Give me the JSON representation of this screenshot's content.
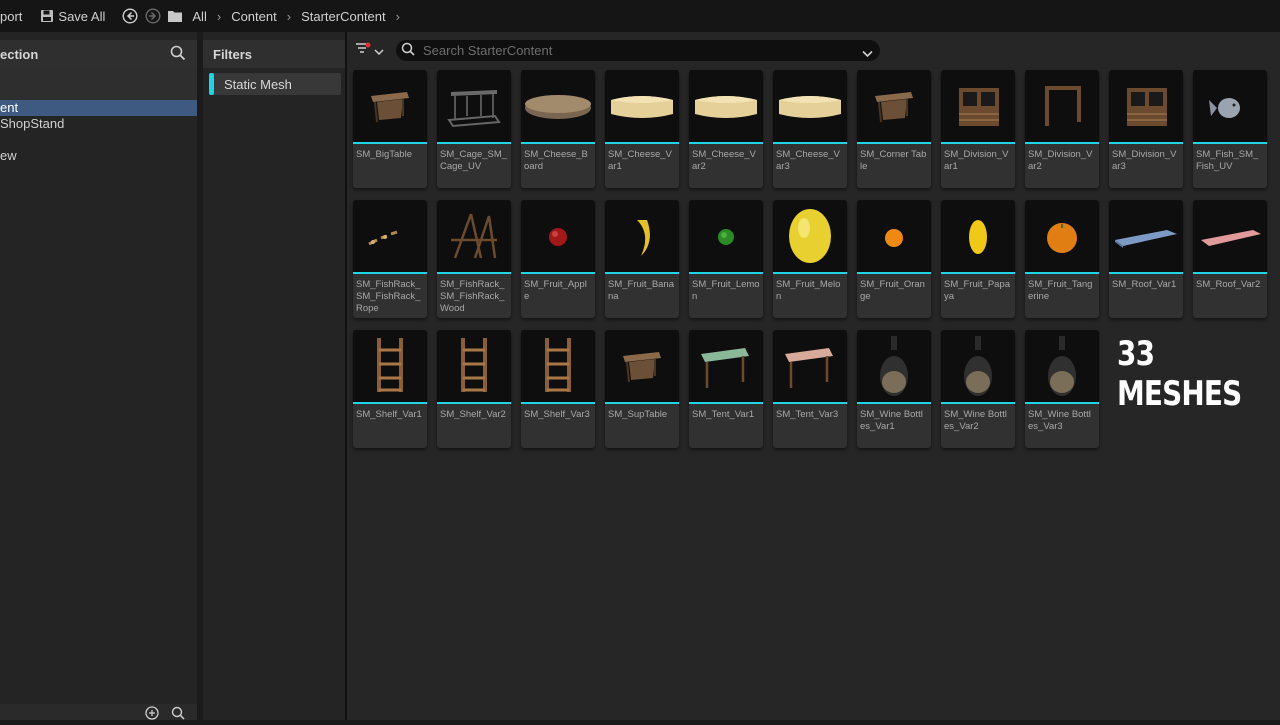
{
  "topbar": {
    "import_label": "port",
    "save_all_label": "Save All",
    "breadcrumb": [
      "All",
      "Content",
      "StarterContent"
    ]
  },
  "left_panel": {
    "header": "ection",
    "tree": [
      {
        "label": "",
        "selected": false
      },
      {
        "label": "",
        "selected": false
      },
      {
        "label": "ent",
        "selected": true
      },
      {
        "label": "ShopStand",
        "selected": false
      },
      {
        "label": "",
        "selected": false
      },
      {
        "label": "ew",
        "selected": false
      }
    ]
  },
  "filters": {
    "header": "Filters",
    "items": [
      "Static Mesh"
    ],
    "accent": "#1ed4e6"
  },
  "search": {
    "placeholder": "Search StarterContent",
    "value": ""
  },
  "assets": [
    {
      "label": "SM_BigTable",
      "icon": "table"
    },
    {
      "label": "SM_Cage_SM_Cage_UV",
      "icon": "cage"
    },
    {
      "label": "SM_Cheese_Board",
      "icon": "board"
    },
    {
      "label": "SM_Cheese_Var1",
      "icon": "cheese"
    },
    {
      "label": "SM_Cheese_Var2",
      "icon": "cheese"
    },
    {
      "label": "SM_Cheese_Var3",
      "icon": "cheese"
    },
    {
      "label": "SM_Corner Table",
      "icon": "table"
    },
    {
      "label": "SM_Division_Var1",
      "icon": "division"
    },
    {
      "label": "SM_Division_Var2",
      "icon": "frame"
    },
    {
      "label": "SM_Division_Var3",
      "icon": "division"
    },
    {
      "label": "SM_Fish_SM_Fish_UV",
      "icon": "fish"
    },
    {
      "label": "SM_FishRack_SM_FishRack_Rope",
      "icon": "rope"
    },
    {
      "label": "SM_FishRack_SM_FishRack_Wood",
      "icon": "rack"
    },
    {
      "label": "SM_Fruit_Apple",
      "icon": "apple"
    },
    {
      "label": "SM_Fruit_Banana",
      "icon": "banana"
    },
    {
      "label": "SM_Fruit_Lemon",
      "icon": "lemon"
    },
    {
      "label": "SM_Fruit_Melon",
      "icon": "melon"
    },
    {
      "label": "SM_Fruit_Orange",
      "icon": "orange"
    },
    {
      "label": "SM_Fruit_Papaya",
      "icon": "papaya"
    },
    {
      "label": "SM_Fruit_Tangerine",
      "icon": "tangerine"
    },
    {
      "label": "SM_Roof_Var1",
      "icon": "roof-blue"
    },
    {
      "label": "SM_Roof_Var2",
      "icon": "roof-pink"
    },
    {
      "label": "SM_Shelf_Var1",
      "icon": "shelf"
    },
    {
      "label": "SM_Shelf_Var2",
      "icon": "shelf"
    },
    {
      "label": "SM_Shelf_Var3",
      "icon": "shelf"
    },
    {
      "label": "SM_SupTable",
      "icon": "table"
    },
    {
      "label": "SM_Tent_Var1",
      "icon": "tent-green"
    },
    {
      "label": "SM_Tent_Var3",
      "icon": "tent-pink"
    },
    {
      "label": "SM_Wine Bottles_Var1",
      "icon": "bottle"
    },
    {
      "label": "SM_Wine Bottles_Var2",
      "icon": "bottle"
    },
    {
      "label": "SM_Wine Bottles_Var3",
      "icon": "bottle"
    }
  ],
  "overlay_text": "33 MESHES"
}
